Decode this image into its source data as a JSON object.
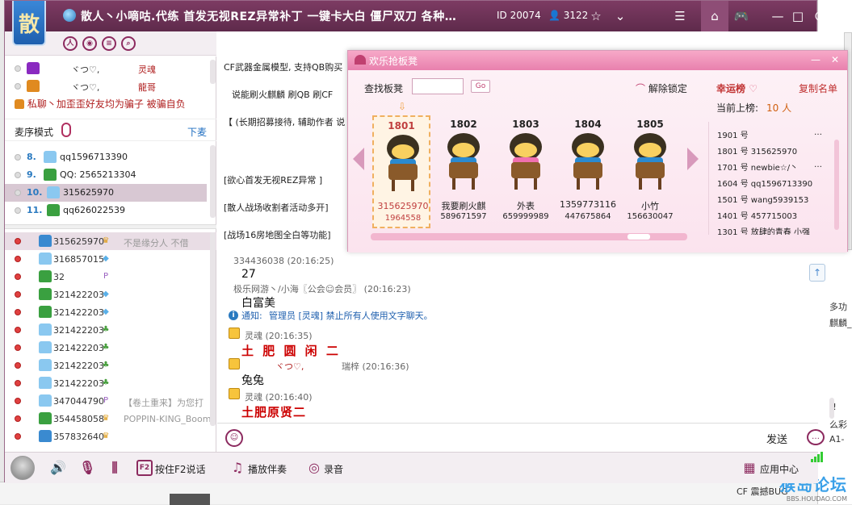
{
  "room": {
    "title": "散人丶小嘀咕.代练   首发无视REZ异常补丁   一键卡大白   僵尸双刀   各种…",
    "id": "ID 20074",
    "online": "3122",
    "logo_char": "散"
  },
  "titlebar": {
    "icons": [
      "star-icon",
      "list-icon",
      "home-icon",
      "gamepad-icon",
      "minimize-icon",
      "maximize-icon",
      "power-icon"
    ]
  },
  "mic_list": [
    {
      "name": "ヾつ♡,",
      "role": "灵魂"
    },
    {
      "name": "ヾつ♡,",
      "role": "龍哥"
    }
  ],
  "notice": "私聊丶加歪歪好友均为骗子 被骗自负",
  "queue": {
    "label": "麦序模式",
    "down_label": "下麦",
    "items": [
      {
        "num": "8.",
        "name": "qq1596713390",
        "color": "#3a8ad0"
      },
      {
        "num": "9.",
        "name": "QQ: 2565213304",
        "color": "#3aa040"
      },
      {
        "num": "10.",
        "name": "315625970",
        "color": "#3a8ad0"
      },
      {
        "num": "11.",
        "name": "qq626022539",
        "color": "#3aa040"
      }
    ]
  },
  "users": [
    {
      "name": "315625970",
      "extra": "不是缘分人 不借",
      "shirt": "#3a8ad0",
      "badge": "crown"
    },
    {
      "name": "316857015",
      "extra": "",
      "shirt": "#8ac8f0",
      "badge": "diamond"
    },
    {
      "name": "32",
      "extra": "",
      "shirt": "#3aa040",
      "badge": "p"
    },
    {
      "name": "321422203",
      "extra": "",
      "shirt": "#3aa040",
      "badge": "diamond"
    },
    {
      "name": "321422203",
      "extra": "",
      "shirt": "#3aa040",
      "badge": "diamond"
    },
    {
      "name": "321422203",
      "extra": "",
      "shirt": "#8ac8f0",
      "badge": "leaf"
    },
    {
      "name": "321422203",
      "extra": "",
      "shirt": "#8ac8f0",
      "badge": "leaf"
    },
    {
      "name": "321422203",
      "extra": "",
      "shirt": "#8ac8f0",
      "badge": "leaf"
    },
    {
      "name": "321422203",
      "extra": "",
      "shirt": "#8ac8f0",
      "badge": "leaf"
    },
    {
      "name": "347044790",
      "extra": "【卷土重来】为您打",
      "shirt": "#8ac8f0",
      "badge": "p"
    },
    {
      "name": "354458058",
      "extra": "POPPIN-KING_Boom",
      "shirt": "#3aa040",
      "badge": "crown"
    },
    {
      "name": "357832640",
      "extra": "",
      "shirt": "#3a8ad0",
      "badge": "crown"
    }
  ],
  "announcements": [
    "CF武器金属模型, 支持QB购买",
    "说能刷火麒麟   刷QB   刷CF",
    "【 (长期招募接待, 辅助作者 说",
    "[欲心首发无视REZ异常    ]",
    "[散人战场收割者活动多开]",
    "[战场16房地图全白等功能]"
  ],
  "chat": {
    "m0_meta": "334436038   (20:16:25)",
    "m0_text": "27",
    "m1_meta": "极乐网游丶/小海〖公会☺会员〗  (20:16:23)",
    "m1_text": "白富美",
    "sys_prefix": "通知:",
    "sys_text": "管理员 [灵魂] 禁止所有人使用文字聊天。",
    "m2_meta": "灵魂   (20:16:35)",
    "m2_text": "土 肥 圆 闲 二",
    "m3_meta_a": "ヾつ♡,",
    "m3_meta_b": "瑞梓   (20:16:36)",
    "m3_text": "兔兔",
    "m4_meta": "灵魂   (20:16:40)",
    "m4_text": "土肥原贤二"
  },
  "input": {
    "send_label": "发送"
  },
  "bottombar": {
    "ptt_label": "按住F2说话",
    "music_label": "播放伴奏",
    "record_label": "录音",
    "app_center_label": "应用中心"
  },
  "popup": {
    "title": "欢乐抢板凳",
    "search_label": "查找板凳",
    "search_value": "",
    "go_label": "Go",
    "unlock_label": "解除锁定",
    "lucky_label": "幸运榜",
    "copy_label": "复制名单",
    "count_label": "当前上榜:",
    "count_value": "10 人",
    "seats": [
      {
        "num": "1801",
        "nick": "315625970",
        "qid": "1964558",
        "active": true,
        "pink": false
      },
      {
        "num": "1802",
        "nick": "我要刷火麒",
        "qid": "589671597",
        "active": false,
        "pink": false
      },
      {
        "num": "1803",
        "nick": "外表",
        "qid": "659999989",
        "active": false,
        "pink": true
      },
      {
        "num": "1804",
        "nick": "1359773116",
        "qid": "447675864",
        "active": false,
        "pink": false
      },
      {
        "num": "1805",
        "nick": "小竹",
        "qid": "156630047",
        "active": false,
        "pink": false
      }
    ],
    "ranks": [
      {
        "text": "1901 号",
        "dots": "…"
      },
      {
        "text": "1801 号 315625970",
        "dots": ""
      },
      {
        "text": "1701 号 newbie☆/丶",
        "dots": "…"
      },
      {
        "text": "1604 号 qq1596713390",
        "dots": ""
      },
      {
        "text": "1501 号 wang5939153",
        "dots": ""
      },
      {
        "text": "1401 号 457715003",
        "dots": ""
      },
      {
        "text": "1301 号 放肆的青春  小强",
        "dots": ""
      }
    ]
  },
  "background": {
    "right_texts": [
      "多功",
      "麒麟_",
      "!!",
      "么彩",
      "A1-",
      "CF 震撼BUG"
    ],
    "watermark_main": "猴岛论坛",
    "watermark_sub": "BBS.HOUDAO.COM"
  }
}
